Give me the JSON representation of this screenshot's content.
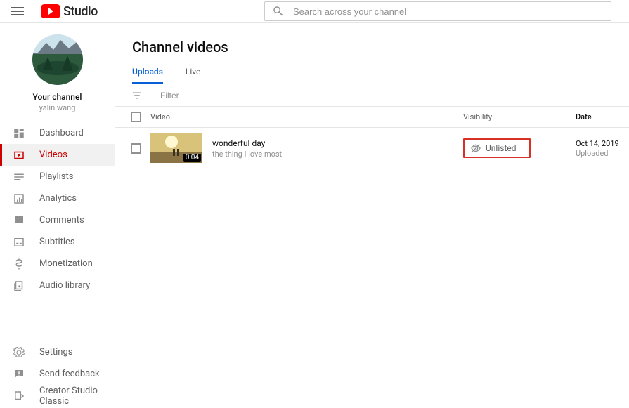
{
  "header": {
    "studio_label": "Studio",
    "search_placeholder": "Search across your channel"
  },
  "sidebar": {
    "your_channel_label": "Your channel",
    "channel_name": "yalin wang",
    "items": [
      {
        "label": "Dashboard"
      },
      {
        "label": "Videos"
      },
      {
        "label": "Playlists"
      },
      {
        "label": "Analytics"
      },
      {
        "label": "Comments"
      },
      {
        "label": "Subtitles"
      },
      {
        "label": "Monetization"
      },
      {
        "label": "Audio library"
      }
    ],
    "bottom": [
      {
        "label": "Settings"
      },
      {
        "label": "Send feedback"
      },
      {
        "label": "Creator Studio Classic"
      }
    ]
  },
  "main": {
    "title": "Channel videos",
    "tabs": [
      {
        "label": "Uploads"
      },
      {
        "label": "Live"
      }
    ],
    "filter_placeholder": "Filter",
    "columns": {
      "video": "Video",
      "visibility": "Visibility",
      "date": "Date"
    },
    "rows": [
      {
        "title": "wonderful day",
        "description": "the thing I love most",
        "duration": "0:04",
        "visibility": "Unlisted",
        "date": "Oct 14, 2019",
        "date_sub": "Uploaded"
      }
    ]
  },
  "colors": {
    "brand_red": "#ff0000",
    "active_red": "#cc0000",
    "link_blue": "#065fd4",
    "highlight_border": "#d93025"
  }
}
